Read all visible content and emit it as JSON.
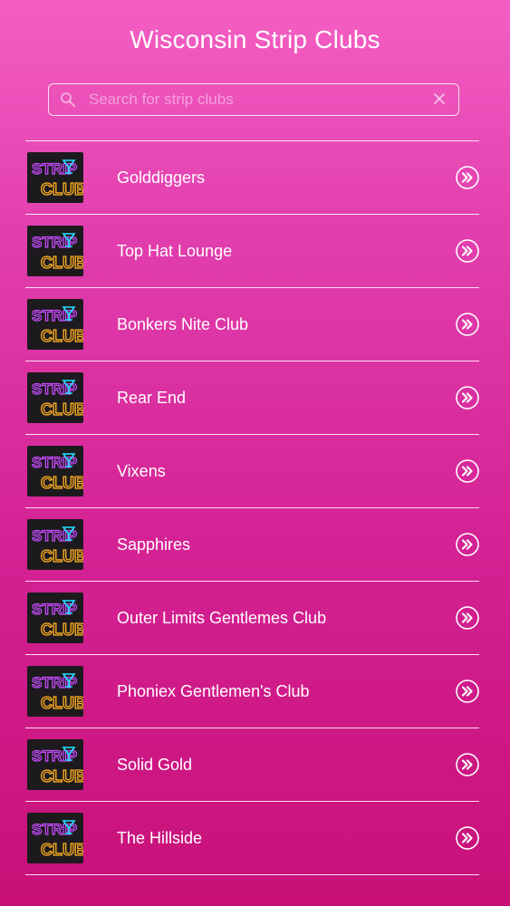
{
  "header": {
    "title": "Wisconsin Strip Clubs"
  },
  "search": {
    "placeholder": "Search for strip clubs",
    "value": "",
    "icon": "search-icon",
    "clear_icon": "clear-icon"
  },
  "thumbnail": {
    "line1": "STRIP",
    "line2": "CLUBS",
    "color_line1": "#c84cff",
    "color_line2": "#ffb020",
    "color_glass": "#22e0ff"
  },
  "clubs": [
    {
      "name": "Golddiggers"
    },
    {
      "name": "Top Hat Lounge"
    },
    {
      "name": "Bonkers Nite Club"
    },
    {
      "name": "Rear End"
    },
    {
      "name": "Vixens"
    },
    {
      "name": "Sapphires"
    },
    {
      "name": "Outer Limits Gentlemes Club"
    },
    {
      "name": "Phoniex Gentlemen's Club"
    },
    {
      "name": "Solid Gold"
    },
    {
      "name": "The Hillside"
    }
  ],
  "colors": {
    "background_top": "#f45fc3",
    "background_bottom": "#c81078",
    "foreground": "#ffffff"
  }
}
